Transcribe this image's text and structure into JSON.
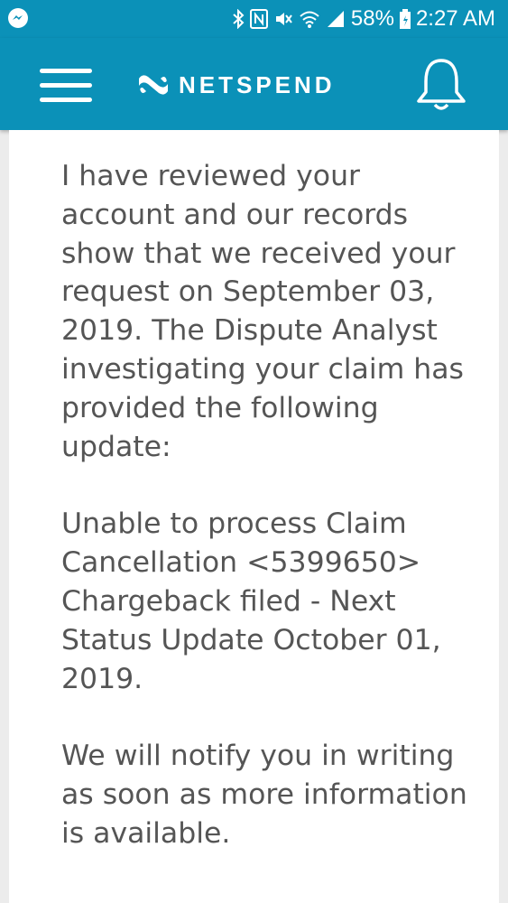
{
  "status_bar": {
    "battery": "58%",
    "time": "2:27 AM",
    "icons": [
      "messenger-icon",
      "bluetooth-icon",
      "nfc-icon",
      "mute-icon",
      "wifi-icon",
      "signal-icon",
      "battery-icon"
    ]
  },
  "app_bar": {
    "logo_text": "NETSPEND",
    "menu_icon": "hamburger-icon",
    "notification_icon": "bell-icon"
  },
  "message": {
    "paragraph_1": "I have reviewed your account and our records show that we received your request on September 03, 2019. The Dispute Analyst investigating your claim has provided the following update:",
    "paragraph_2": "Unable to process Claim Cancellation <5399650> Chargeback filed - Next Status Update October 01, 2019.",
    "paragraph_3": "We will notify you in writing as soon as more information is available."
  },
  "colors": {
    "brand": "#0b91b8",
    "text": "#555555",
    "background": "#ffffff"
  }
}
